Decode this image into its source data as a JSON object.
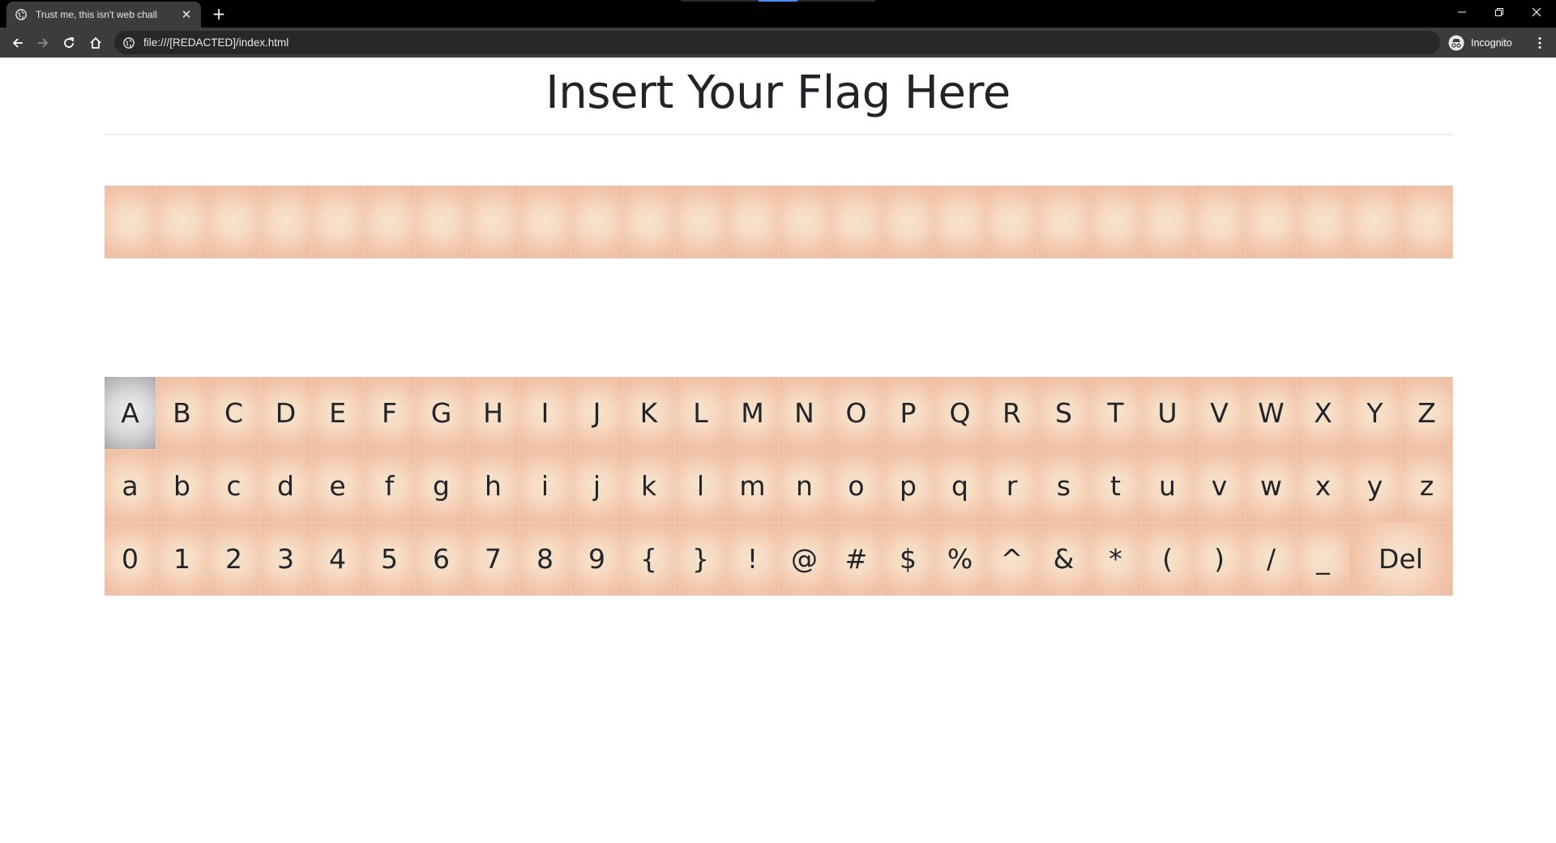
{
  "browser": {
    "tab_title": "Trust me, this isn't web chall",
    "tab_close": "✕",
    "new_tab": "+",
    "url": "file:///[REDACTED]/index.html",
    "profile_label": "Incognito"
  },
  "page": {
    "heading": "Insert Your Flag Here",
    "slot_count": 26
  },
  "keyboard": {
    "selected_key": "A",
    "rows": [
      [
        "A",
        "B",
        "C",
        "D",
        "E",
        "F",
        "G",
        "H",
        "I",
        "J",
        "K",
        "L",
        "M",
        "N",
        "O",
        "P",
        "Q",
        "R",
        "S",
        "T",
        "U",
        "V",
        "W",
        "X",
        "Y",
        "Z"
      ],
      [
        "a",
        "b",
        "c",
        "d",
        "e",
        "f",
        "g",
        "h",
        "i",
        "j",
        "k",
        "l",
        "m",
        "n",
        "o",
        "p",
        "q",
        "r",
        "s",
        "t",
        "u",
        "v",
        "w",
        "x",
        "y",
        "z"
      ],
      [
        "0",
        "1",
        "2",
        "3",
        "4",
        "5",
        "6",
        "7",
        "8",
        "9",
        "{",
        "}",
        "!",
        "@",
        "#",
        "$",
        "%",
        "^",
        "&",
        "*",
        "(",
        ")",
        "/",
        "_",
        "Del"
      ]
    ]
  },
  "colors": {
    "tile_center": "#f7e3cc",
    "tile_edge": "#eebca2",
    "selected_tile": "#a8a8a8",
    "heading_text": "#212529"
  }
}
